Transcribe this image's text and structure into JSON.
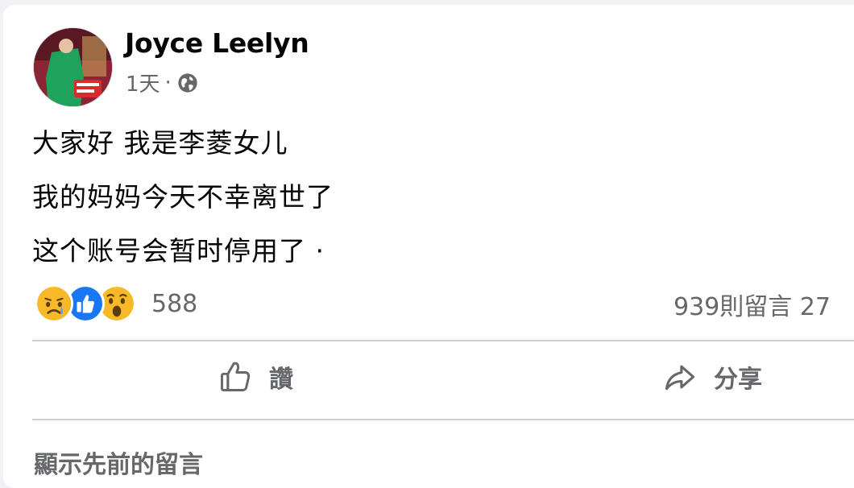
{
  "post": {
    "author": "Joyce Leelyn",
    "time": "1天",
    "separator": "·",
    "privacy_icon": "globe-icon",
    "lines": [
      "大家好 我是李菱女儿",
      "我的妈妈今天不幸离世了",
      "这个账号会暂时停用了 ·"
    ]
  },
  "stats": {
    "reaction_icons": [
      "sad-reaction-icon",
      "like-reaction-icon",
      "wow-reaction-icon"
    ],
    "reaction_count": "588",
    "comments_shares": "939則留言 27"
  },
  "actions": {
    "like_label": "讚",
    "like_icon": "thumbs-up-icon",
    "share_label": "分享",
    "share_icon": "share-arrow-icon"
  },
  "comments": {
    "show_previous": "顯示先前的留言"
  },
  "colors": {
    "text": "#050505",
    "secondary": "#65676b",
    "like_blue": "#1877f2",
    "reaction_yellow": "#f7b928",
    "divider": "#ced0d4"
  }
}
